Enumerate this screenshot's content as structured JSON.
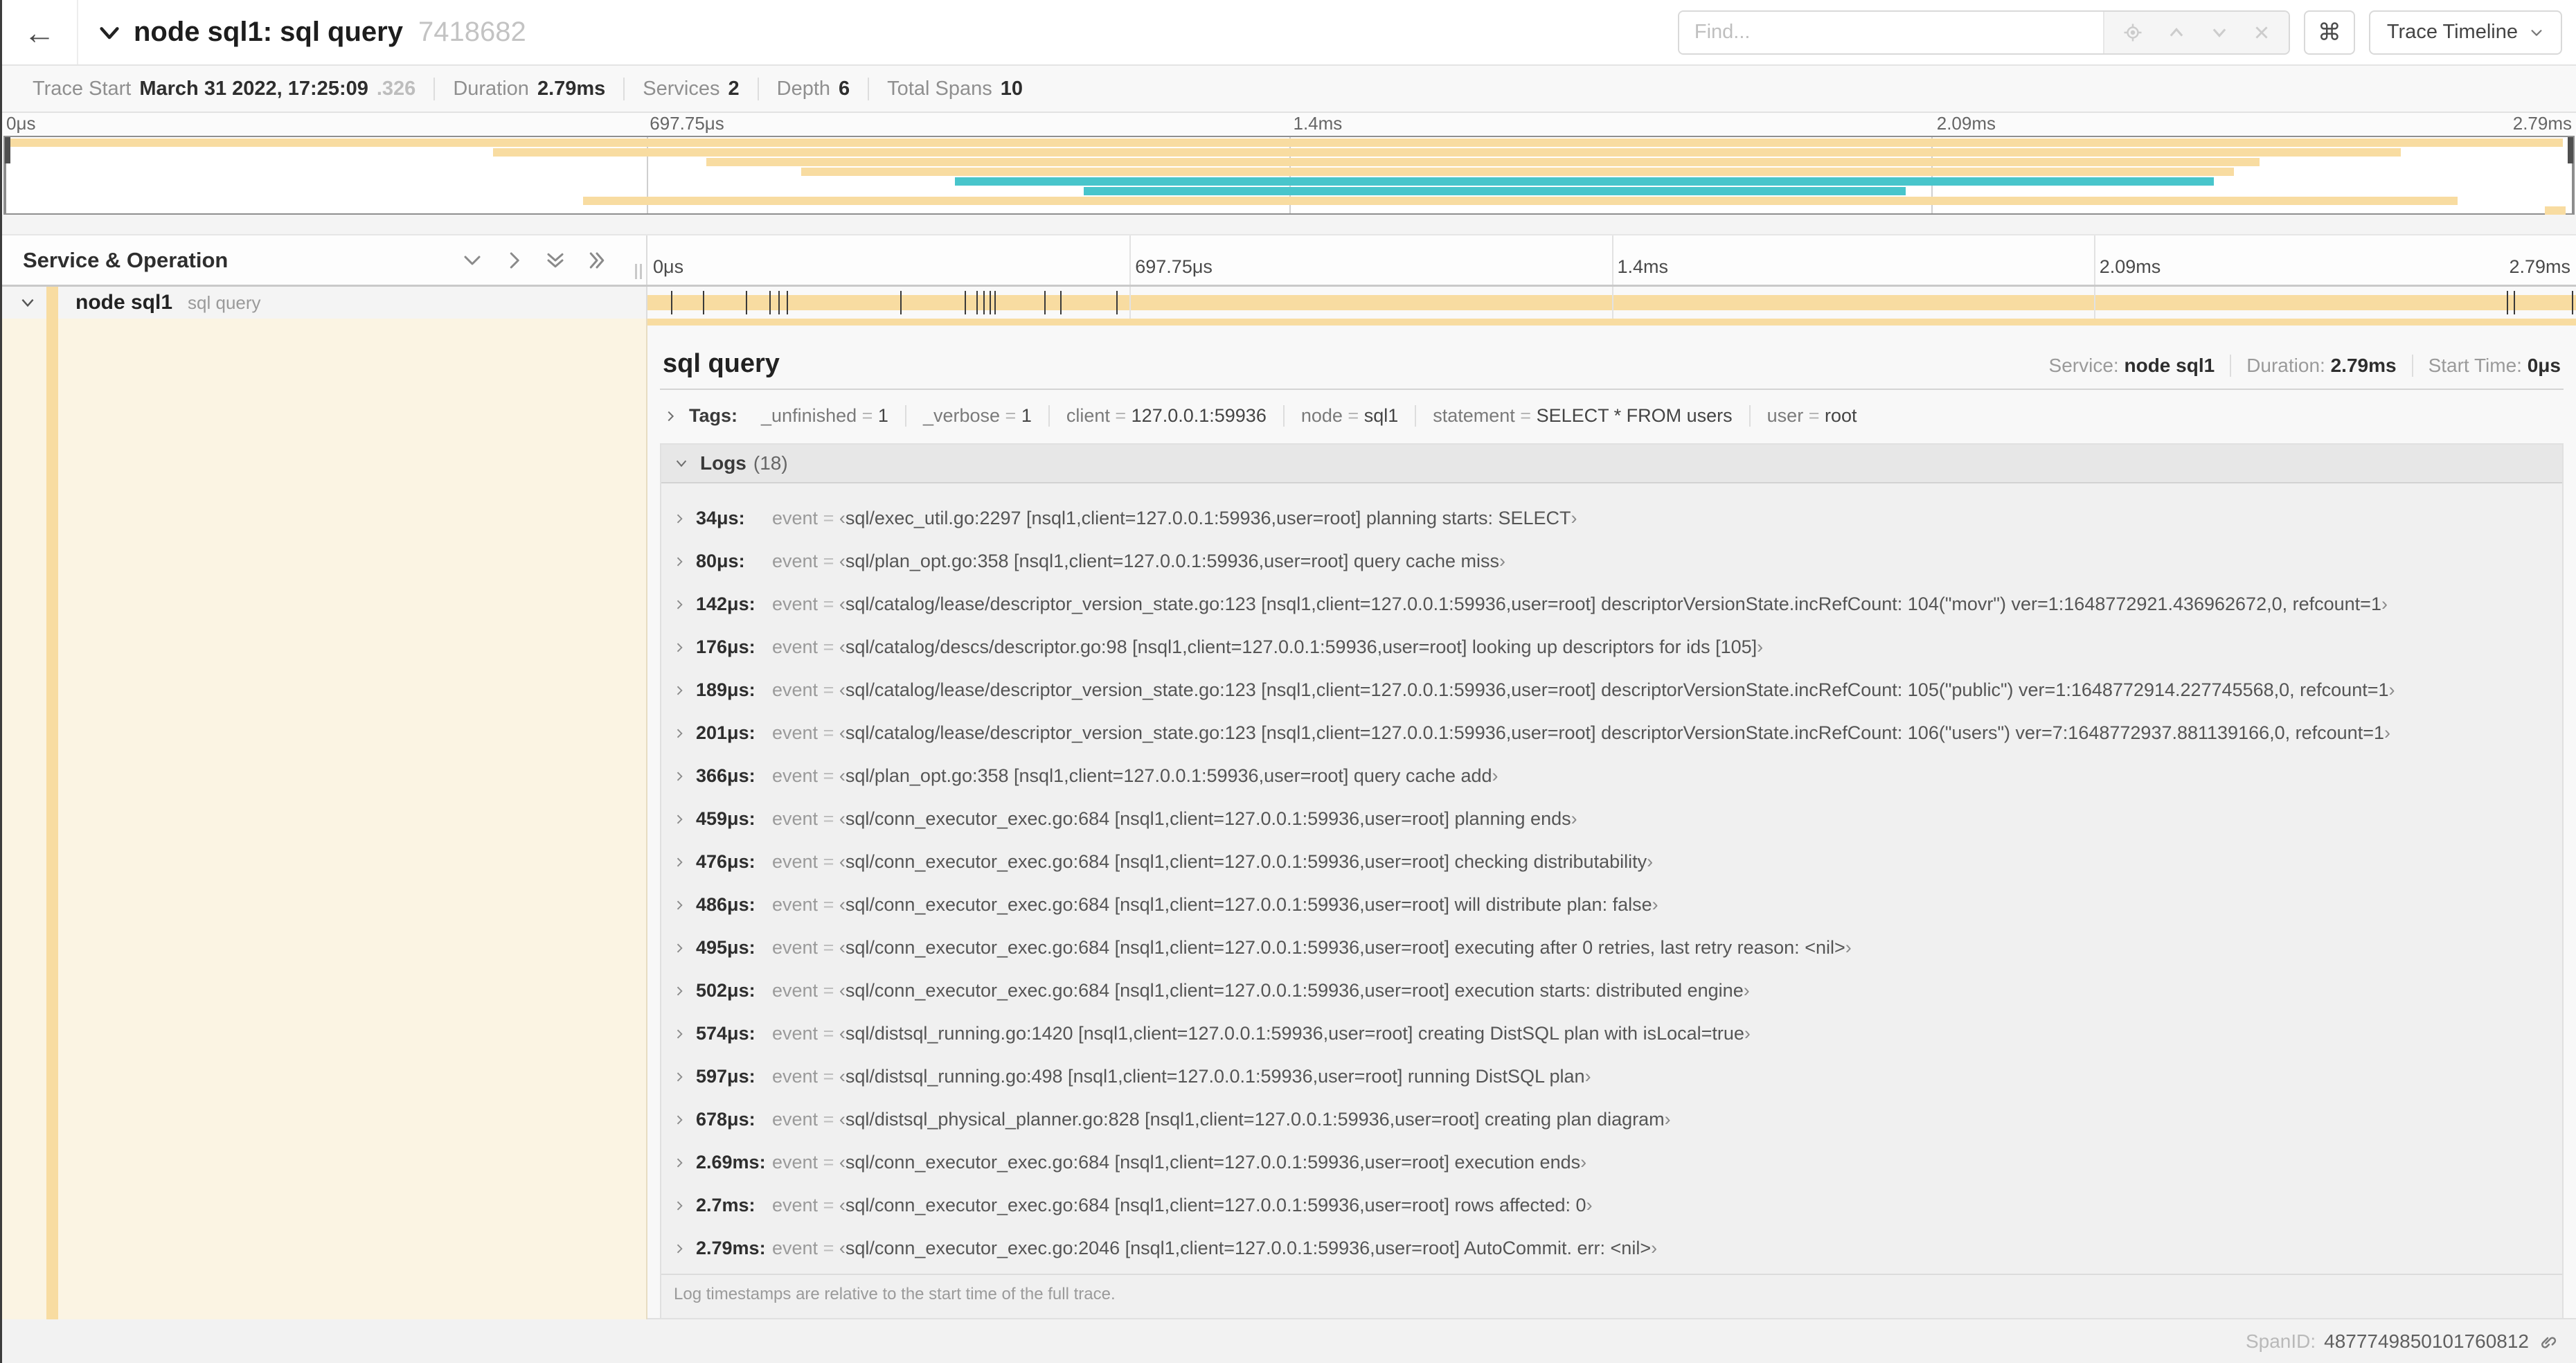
{
  "colors": {
    "tan": "#F8DCA1",
    "teal": "#48C5CB",
    "cream": "#FBF4E3"
  },
  "header": {
    "back_icon": "arrow-left",
    "back_glyph": "←",
    "title": "node sql1: sql query",
    "trace_id_short": "7418682",
    "find_placeholder": "Find...",
    "kbd_button_glyph": "⌘",
    "view_selector_label": "Trace Timeline"
  },
  "trace_info": {
    "items": [
      {
        "label": "Trace Start",
        "value": "March 31 2022, 17:25:09",
        "muted": ".326"
      },
      {
        "label": "Duration",
        "value": "2.79ms",
        "muted": ""
      },
      {
        "label": "Services",
        "value": "2",
        "muted": ""
      },
      {
        "label": "Depth",
        "value": "6",
        "muted": ""
      },
      {
        "label": "Total Spans",
        "value": "10",
        "muted": ""
      }
    ]
  },
  "minimap": {
    "ticks": [
      {
        "label": "0μs",
        "pct": 0
      },
      {
        "label": "697.75μs",
        "pct": 25
      },
      {
        "label": "1.4ms",
        "pct": 50
      },
      {
        "label": "2.09ms",
        "pct": 75
      },
      {
        "label": "2.79ms",
        "pct": 100
      }
    ],
    "grid_percents": [
      25,
      50,
      75
    ],
    "rows": [
      {
        "color": "tan",
        "start": 0,
        "end": 99.6
      },
      {
        "color": "tan",
        "start": 19,
        "end": 93.3
      },
      {
        "color": "tan",
        "start": 27.3,
        "end": 87.8
      },
      {
        "color": "tan",
        "start": 31,
        "end": 86.8
      },
      {
        "color": "teal",
        "start": 37,
        "end": 86
      },
      {
        "color": "teal",
        "start": 42,
        "end": 74
      },
      {
        "color": "tan",
        "start": 22.5,
        "end": 95.5
      },
      {
        "color": "tan",
        "start": 98.9,
        "end": 99.7
      }
    ]
  },
  "timeline": {
    "left_header": "Service & Operation",
    "ticks": [
      {
        "label": "0μs",
        "pct": 0
      },
      {
        "label": "697.75μs",
        "pct": 25
      },
      {
        "label": "1.4ms",
        "pct": 50
      },
      {
        "label": "2.09ms",
        "pct": 75
      },
      {
        "label": "2.79ms",
        "pct": 100
      }
    ],
    "grid_percents": [
      25,
      50,
      75
    ],
    "span_row": {
      "service": "node sql1",
      "operation": "sql query",
      "bar_start_pct": 0,
      "bar_end_pct": 100,
      "log_marker_percents": [
        1.22,
        2.87,
        5.09,
        6.31,
        6.77,
        7.2,
        13.12,
        16.45,
        17.06,
        17.42,
        17.74,
        17.99,
        20.57,
        21.4,
        24.3,
        96.42,
        96.77,
        99.8
      ]
    }
  },
  "detail": {
    "operation": "sql query",
    "meta": [
      {
        "label": "Service:",
        "value": "node sql1"
      },
      {
        "label": "Duration:",
        "value": "2.79ms"
      },
      {
        "label": "Start Time:",
        "value": "0μs"
      }
    ],
    "tags_title": "Tags:",
    "tags": [
      {
        "key": "_unfinished",
        "value": "1"
      },
      {
        "key": "_verbose",
        "value": "1"
      },
      {
        "key": "client",
        "value": "127.0.0.1:59936"
      },
      {
        "key": "node",
        "value": "sql1"
      },
      {
        "key": "statement",
        "value": "SELECT * FROM users"
      },
      {
        "key": "user",
        "value": "root"
      }
    ],
    "logs_title": "Logs",
    "logs_count": "(18)",
    "logs_field_label": "event",
    "logs": [
      {
        "ts": "34μs:",
        "message": "sql/exec_util.go:2297 [nsql1,client=127.0.0.1:59936,user=root] planning starts: SELECT"
      },
      {
        "ts": "80μs:",
        "message": "sql/plan_opt.go:358 [nsql1,client=127.0.0.1:59936,user=root] query cache miss"
      },
      {
        "ts": "142μs:",
        "message": "sql/catalog/lease/descriptor_version_state.go:123 [nsql1,client=127.0.0.1:59936,user=root] descriptorVersionState.incRefCount: 104(\"movr\") ver=1:1648772921.436962672,0, refcount=1"
      },
      {
        "ts": "176μs:",
        "message": "sql/catalog/descs/descriptor.go:98 [nsql1,client=127.0.0.1:59936,user=root] looking up descriptors for ids [105]"
      },
      {
        "ts": "189μs:",
        "message": "sql/catalog/lease/descriptor_version_state.go:123 [nsql1,client=127.0.0.1:59936,user=root] descriptorVersionState.incRefCount: 105(\"public\") ver=1:1648772914.227745568,0, refcount=1"
      },
      {
        "ts": "201μs:",
        "message": "sql/catalog/lease/descriptor_version_state.go:123 [nsql1,client=127.0.0.1:59936,user=root] descriptorVersionState.incRefCount: 106(\"users\") ver=7:1648772937.881139166,0, refcount=1"
      },
      {
        "ts": "366μs:",
        "message": "sql/plan_opt.go:358 [nsql1,client=127.0.0.1:59936,user=root] query cache add"
      },
      {
        "ts": "459μs:",
        "message": "sql/conn_executor_exec.go:684 [nsql1,client=127.0.0.1:59936,user=root] planning ends"
      },
      {
        "ts": "476μs:",
        "message": "sql/conn_executor_exec.go:684 [nsql1,client=127.0.0.1:59936,user=root] checking distributability"
      },
      {
        "ts": "486μs:",
        "message": "sql/conn_executor_exec.go:684 [nsql1,client=127.0.0.1:59936,user=root] will distribute plan: false"
      },
      {
        "ts": "495μs:",
        "message": "sql/conn_executor_exec.go:684 [nsql1,client=127.0.0.1:59936,user=root] executing after 0 retries, last retry reason: <nil>"
      },
      {
        "ts": "502μs:",
        "message": "sql/conn_executor_exec.go:684 [nsql1,client=127.0.0.1:59936,user=root] execution starts: distributed engine"
      },
      {
        "ts": "574μs:",
        "message": "sql/distsql_running.go:1420 [nsql1,client=127.0.0.1:59936,user=root] creating DistSQL plan with isLocal=true"
      },
      {
        "ts": "597μs:",
        "message": "sql/distsql_running.go:498 [nsql1,client=127.0.0.1:59936,user=root] running DistSQL plan"
      },
      {
        "ts": "678μs:",
        "message": "sql/distsql_physical_planner.go:828 [nsql1,client=127.0.0.1:59936,user=root] creating plan diagram"
      },
      {
        "ts": "2.69ms:",
        "message": "sql/conn_executor_exec.go:684 [nsql1,client=127.0.0.1:59936,user=root] execution ends"
      },
      {
        "ts": "2.7ms:",
        "message": "sql/conn_executor_exec.go:684 [nsql1,client=127.0.0.1:59936,user=root] rows affected: 0"
      },
      {
        "ts": "2.79ms:",
        "message": "sql/conn_executor_exec.go:2046 [nsql1,client=127.0.0.1:59936,user=root] AutoCommit. err: <nil>"
      }
    ],
    "logs_note": "Log timestamps are relative to the start time of the full trace.",
    "spanid_label": "SpanID:",
    "spanid": "4877749850101760812"
  }
}
